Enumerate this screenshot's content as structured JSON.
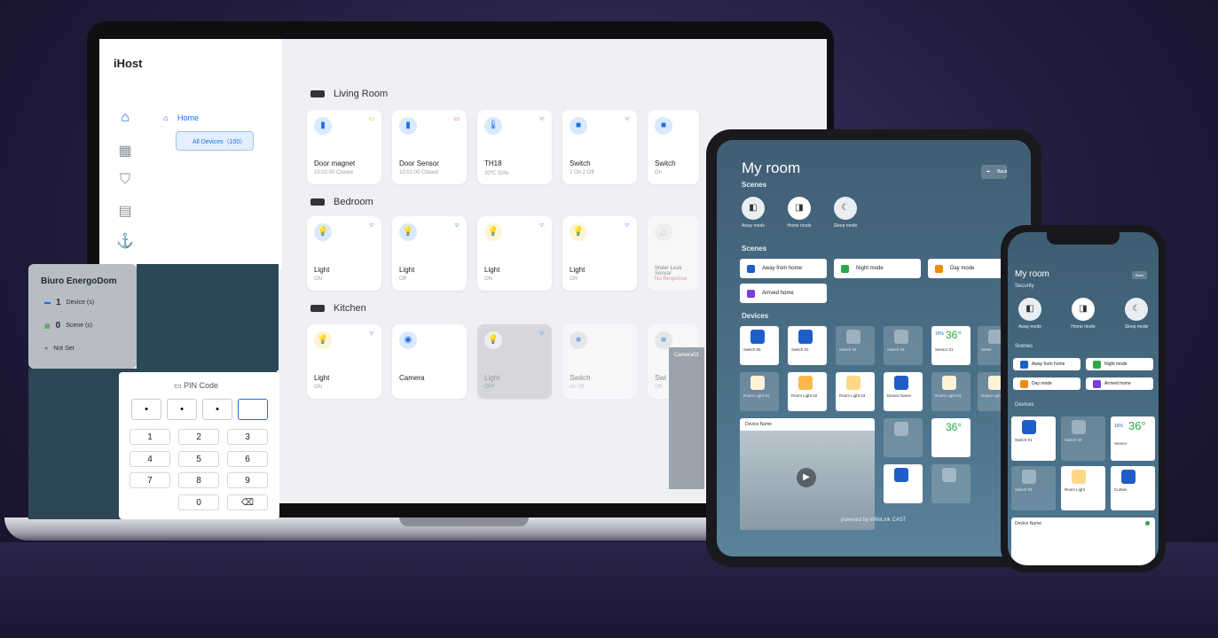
{
  "laptop": {
    "brand": "iHost",
    "tree": {
      "home": "Home",
      "all_devices": "All Devices（100）"
    },
    "rooms": [
      {
        "name": "Living Room",
        "devices": [
          {
            "name": "Door magnet",
            "status": "10:02:00 Closed"
          },
          {
            "name": "Door Sensor",
            "status": "10:02:00 Closed"
          },
          {
            "name": "TH18",
            "status": "20℃  50%"
          },
          {
            "name": "Switch",
            "status": "2 On 2 Off"
          },
          {
            "name": "Switch",
            "status": "On"
          }
        ]
      },
      {
        "name": "Bedroom",
        "devices": [
          {
            "name": "Light",
            "status": "ON"
          },
          {
            "name": "Light",
            "status": "Off"
          },
          {
            "name": "Light",
            "status": "ON"
          },
          {
            "name": "Light",
            "status": "ON"
          },
          {
            "name": "Water Leak Sensor",
            "status": "No Response"
          }
        ]
      },
      {
        "name": "Kitchen",
        "devices": [
          {
            "name": "Light",
            "status": "ON"
          },
          {
            "name": "Camera",
            "status": ""
          },
          {
            "name": "Light",
            "status": "OFF"
          },
          {
            "name": "Switch",
            "status": "All Off"
          },
          {
            "name": "Swi",
            "status": "Off"
          }
        ]
      }
    ],
    "camera_label": "Camera01"
  },
  "overlay": {
    "title": "Biuro EnergoDom",
    "devices": {
      "count": "1",
      "label": "Device (s)"
    },
    "scenes": {
      "count": "0",
      "label": "Scene (s)"
    },
    "status": "Not Set",
    "pin_title": "PIN Code",
    "pin_dots": [
      "•",
      "•",
      "•"
    ],
    "keys": [
      "1",
      "2",
      "3",
      "4",
      "5",
      "6",
      "7",
      "8",
      "9",
      "0",
      "⌫"
    ]
  },
  "tablet": {
    "title": "My room",
    "back": "Back",
    "scenes_title": "Scenes",
    "scene_circles": [
      "Away mode",
      "Home mode",
      "Sleep mode"
    ],
    "scenes2_title": "Scenes",
    "scene_buttons": [
      "Away from home",
      "Night mode",
      "Day mode",
      "Arrived home"
    ],
    "devices_title": "Devices",
    "tiles": [
      "Switch 05",
      "Switch 02",
      "Switch 02",
      "Switch 03",
      "Sensor 01",
      "Water",
      "Room Light 01",
      "Room Light 02",
      "Room Light 03",
      "Device Name",
      "Room Light 04",
      "Room Light"
    ],
    "sensor_value": "36°",
    "sensor_humidity": "16%",
    "camera_name": "Device Name",
    "footer": "powered by eWeLink CAST"
  },
  "phone": {
    "title": "My room",
    "back": "Back",
    "security_title": "Security",
    "modes": [
      "Away mode",
      "Home mode",
      "Sleep mode"
    ],
    "scenes_title": "Scenes",
    "scene_buttons": [
      "Away from home",
      "Night mode",
      "Day mode",
      "Arrived home"
    ],
    "devices_title": "Devices",
    "tiles": [
      "Switch 01",
      "Switch 02",
      "Sensor",
      "Switch 03",
      "Room Light",
      "Curtain"
    ],
    "sensor_value": "36°",
    "sensor_humidity": "16%",
    "device_name": "Device Name"
  },
  "colors": {
    "accent": "#1b6fe0",
    "background": "#211d3d",
    "teal": "#2c4756"
  }
}
